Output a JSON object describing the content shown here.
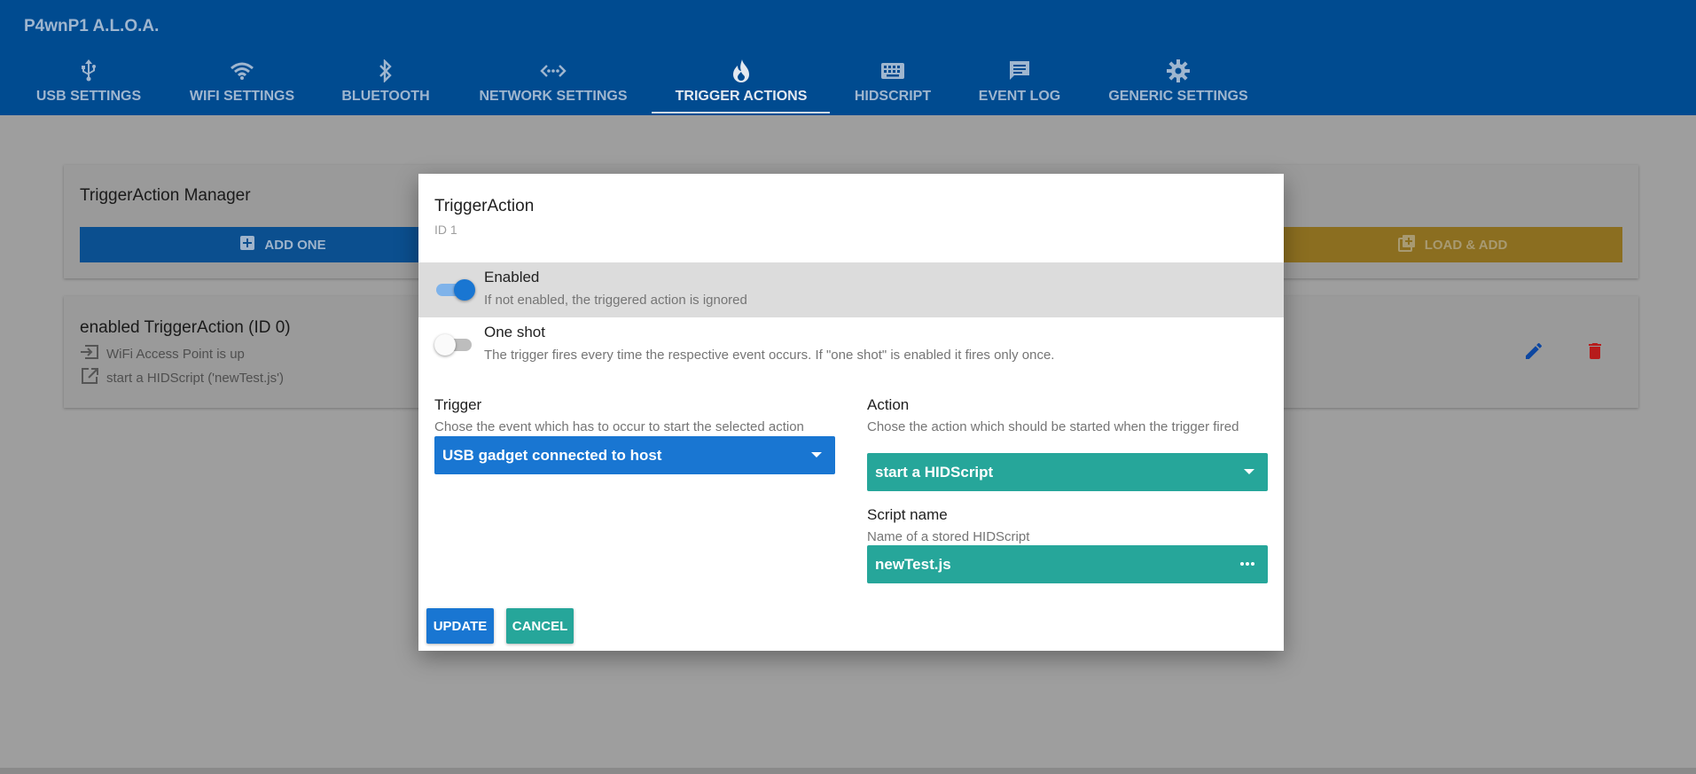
{
  "app": {
    "title": "P4wnP1 A.L.O.A."
  },
  "tabs": [
    {
      "label": "USB SETTINGS",
      "icon": "usb-icon"
    },
    {
      "label": "WIFI SETTINGS",
      "icon": "wifi-icon"
    },
    {
      "label": "BLUETOOTH",
      "icon": "bluetooth-icon"
    },
    {
      "label": "NETWORK SETTINGS",
      "icon": "network-icon"
    },
    {
      "label": "TRIGGER ACTIONS",
      "icon": "fire-icon",
      "active": true
    },
    {
      "label": "HIDSCRIPT",
      "icon": "keyboard-icon"
    },
    {
      "label": "EVENT LOG",
      "icon": "message-icon"
    },
    {
      "label": "GENERIC SETTINGS",
      "icon": "gear-icon"
    }
  ],
  "manager": {
    "title": "TriggerAction Manager",
    "add_label": "ADD ONE",
    "load_label": "LOAD & ADD"
  },
  "trigger_action_card": {
    "title": "enabled TriggerAction (ID 0)",
    "trigger_text": "WiFi Access Point is up",
    "action_text": "start a HIDScript ('newTest.js')"
  },
  "dialog": {
    "title": "TriggerAction",
    "subtitle": "ID 1",
    "enabled": {
      "label": "Enabled",
      "hint": "If not enabled, the triggered action is ignored",
      "value": true
    },
    "one_shot": {
      "label": "One shot",
      "hint": "The trigger fires every time the respective event occurs. If \"one shot\" is enabled it fires only once.",
      "value": false
    },
    "trigger": {
      "label": "Trigger",
      "hint": "Chose the event which has to occur to start the selected action",
      "value": "USB gadget connected to host"
    },
    "action": {
      "label": "Action",
      "hint": "Chose the action which should be started when the trigger fired",
      "value": "start a HIDScript"
    },
    "script_name": {
      "label": "Script name",
      "hint": "Name of a stored HIDScript",
      "value": "newTest.js"
    },
    "update_label": "UPDATE",
    "cancel_label": "CANCEL"
  },
  "colors": {
    "header": "#004b90",
    "primary": "#1976d2",
    "teal": "#26a69a",
    "overlay": "#9e9e9e"
  }
}
